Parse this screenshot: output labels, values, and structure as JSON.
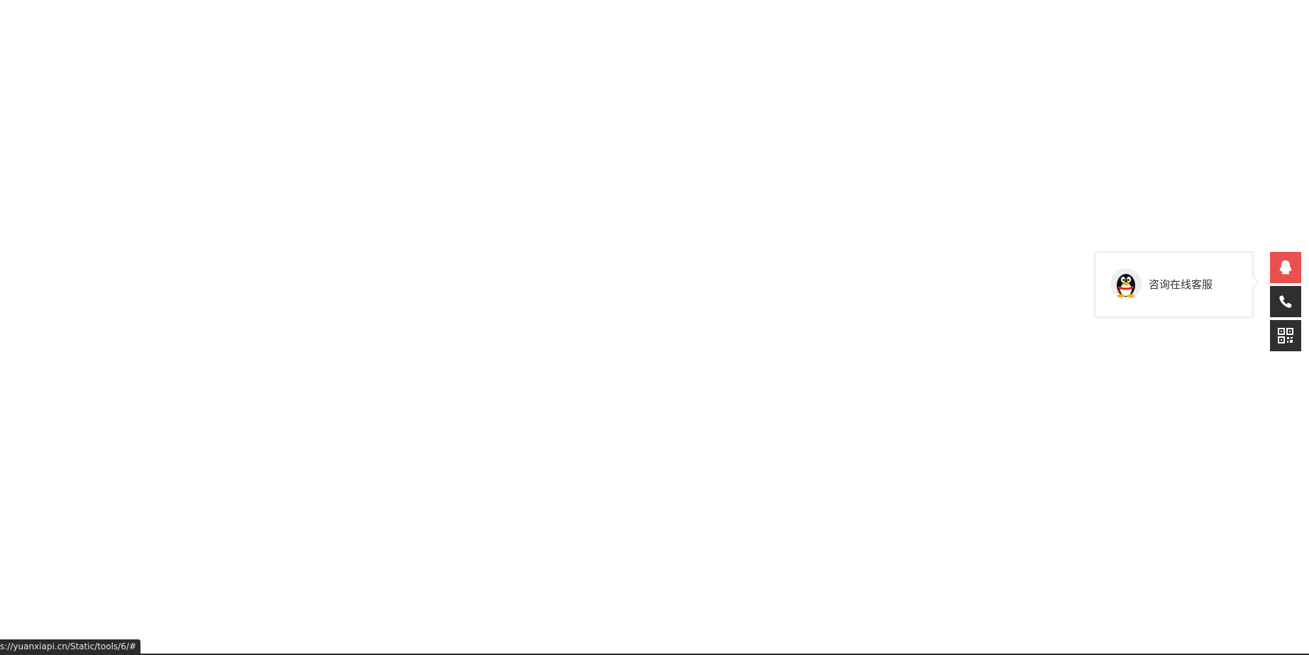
{
  "popup": {
    "consult_label": "咨询在线客服"
  },
  "side_toolbar": {
    "items": [
      {
        "icon": "qq-penguin-icon",
        "active": true
      },
      {
        "icon": "phone-icon",
        "active": false
      },
      {
        "icon": "qr-code-icon",
        "active": false
      }
    ],
    "active_color": "#e9504f",
    "inactive_color": "#2f2f2f"
  },
  "status_bar": {
    "url": "s://yuanxiapi.cn/Static/tools/6/#"
  }
}
